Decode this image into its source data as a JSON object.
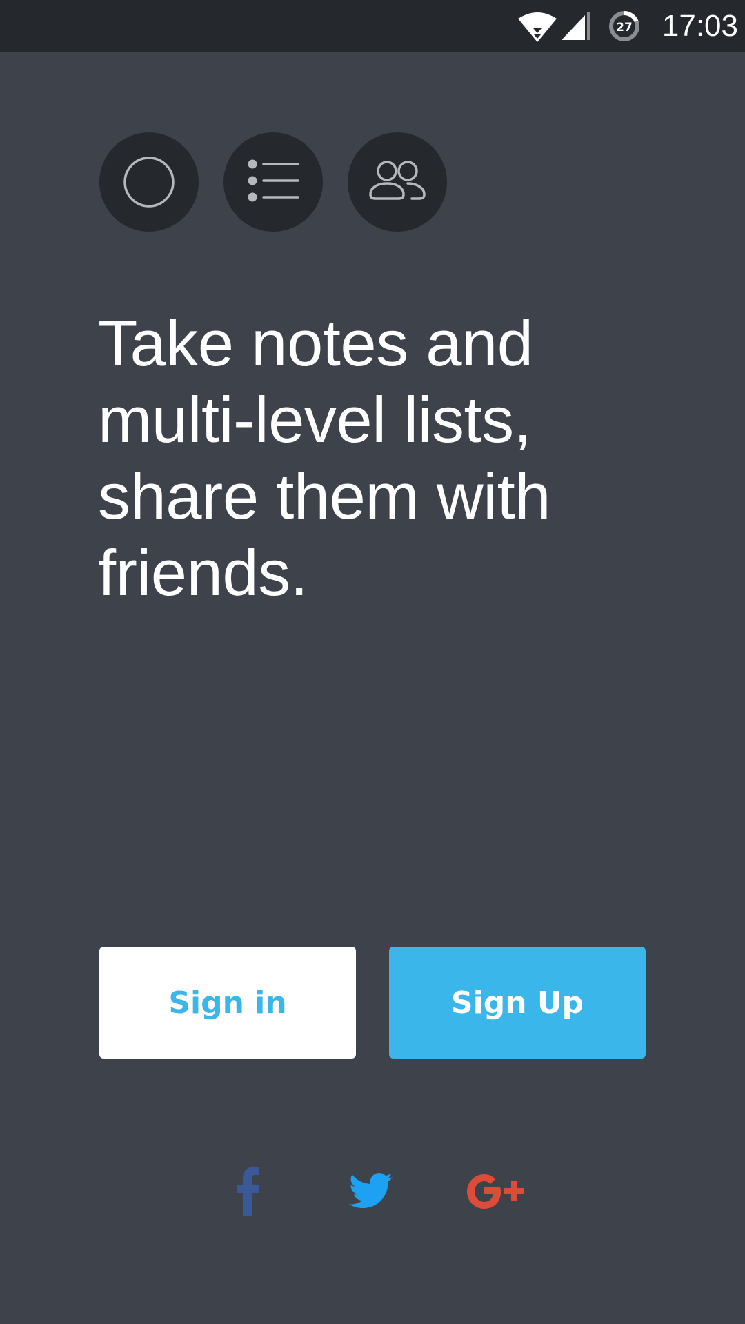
{
  "status_bar": {
    "time": "17:03",
    "battery_level": "27",
    "icons": [
      "wifi-icon",
      "cell-signal-icon",
      "battery-saver-icon"
    ]
  },
  "features": [
    {
      "icon": "circle-icon"
    },
    {
      "icon": "list-icon"
    },
    {
      "icon": "people-icon"
    }
  ],
  "headline": "Take notes and multi-level lists, share them with friends.",
  "buttons": {
    "sign_in": "Sign in",
    "sign_up": "Sign Up"
  },
  "social": [
    {
      "icon": "facebook-icon",
      "color": "#3b5998"
    },
    {
      "icon": "twitter-icon",
      "color": "#1da1f2"
    },
    {
      "icon": "google-plus-icon",
      "color": "#dd4b39"
    }
  ],
  "colors": {
    "background": "#3d424b",
    "status_bar": "#25282d",
    "accent": "#3bb6eb",
    "icon_stroke": "#b5b8bd"
  }
}
